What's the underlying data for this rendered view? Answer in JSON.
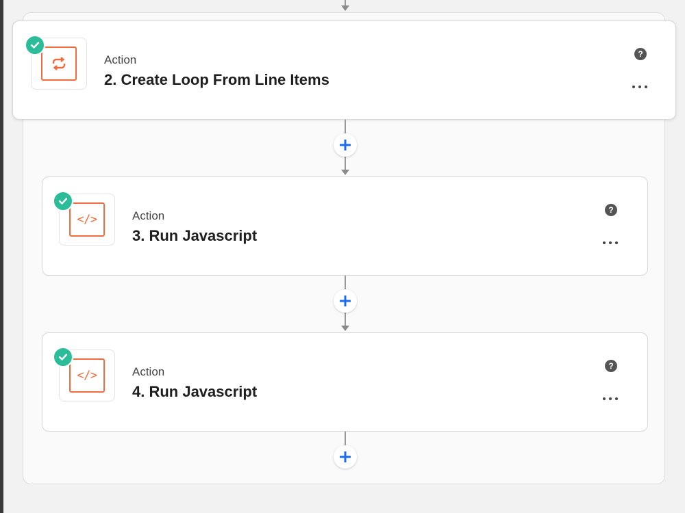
{
  "steps": [
    {
      "type_label": "Action",
      "title": "2. Create Loop From Line Items",
      "icon": "loop-icon",
      "status": "complete",
      "help_glyph": "?"
    },
    {
      "type_label": "Action",
      "title": "3. Run Javascript",
      "icon": "code-icon",
      "status": "complete",
      "help_glyph": "?",
      "icon_glyph": "</>"
    },
    {
      "type_label": "Action",
      "title": "4. Run Javascript",
      "icon": "code-icon",
      "status": "complete",
      "help_glyph": "?",
      "icon_glyph": "</>"
    }
  ],
  "colors": {
    "brand_orange": "#f26b3a",
    "success_green": "#2bbd9a",
    "add_blue": "#1a6cf0",
    "connector_gray": "#9a9a9a"
  }
}
